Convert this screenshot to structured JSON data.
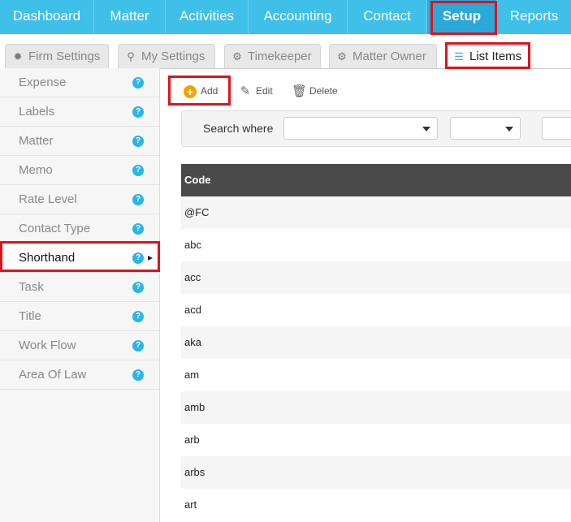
{
  "topnav": {
    "items": [
      {
        "label": "Dashboard"
      },
      {
        "label": "Matter"
      },
      {
        "label": "Activities"
      },
      {
        "label": "Accounting"
      },
      {
        "label": "Contact"
      },
      {
        "label": "Setup"
      },
      {
        "label": "Reports"
      }
    ],
    "active": "Setup"
  },
  "subtabs": {
    "items": [
      {
        "label": "Firm Settings",
        "icon": "gear-icon"
      },
      {
        "label": "My Settings",
        "icon": "wrench-icon"
      },
      {
        "label": "Timekeeper",
        "icon": "gears-icon"
      },
      {
        "label": "Matter Owner",
        "icon": "gear-icon"
      },
      {
        "label": "List Items",
        "icon": "list-icon"
      }
    ],
    "active": "List Items"
  },
  "sidebar": {
    "items": [
      {
        "label": "Expense"
      },
      {
        "label": "Labels"
      },
      {
        "label": "Matter"
      },
      {
        "label": "Memo"
      },
      {
        "label": "Rate Level"
      },
      {
        "label": "Contact Type"
      },
      {
        "label": "Shorthand"
      },
      {
        "label": "Task"
      },
      {
        "label": "Title"
      },
      {
        "label": "Work Flow"
      },
      {
        "label": "Area Of Law"
      }
    ],
    "active": "Shorthand",
    "help_glyph": "?"
  },
  "toolbar": {
    "add_label": "Add",
    "edit_label": "Edit",
    "delete_label": "Delete"
  },
  "search": {
    "label": "Search where",
    "field_value": "",
    "operator_value": "",
    "text_value": ""
  },
  "table": {
    "columns": [
      "Code"
    ],
    "rows": [
      "@FC",
      "abc",
      "acc",
      "acd",
      "aka",
      "am",
      "amb",
      "arb",
      "arbs",
      "art"
    ]
  },
  "colors": {
    "nav_bg": "#3fc0e8",
    "highlight": "#e0121c",
    "table_header": "#4a4a4a",
    "add_icon": "#f4a300",
    "help_icon": "#29b6e8"
  }
}
